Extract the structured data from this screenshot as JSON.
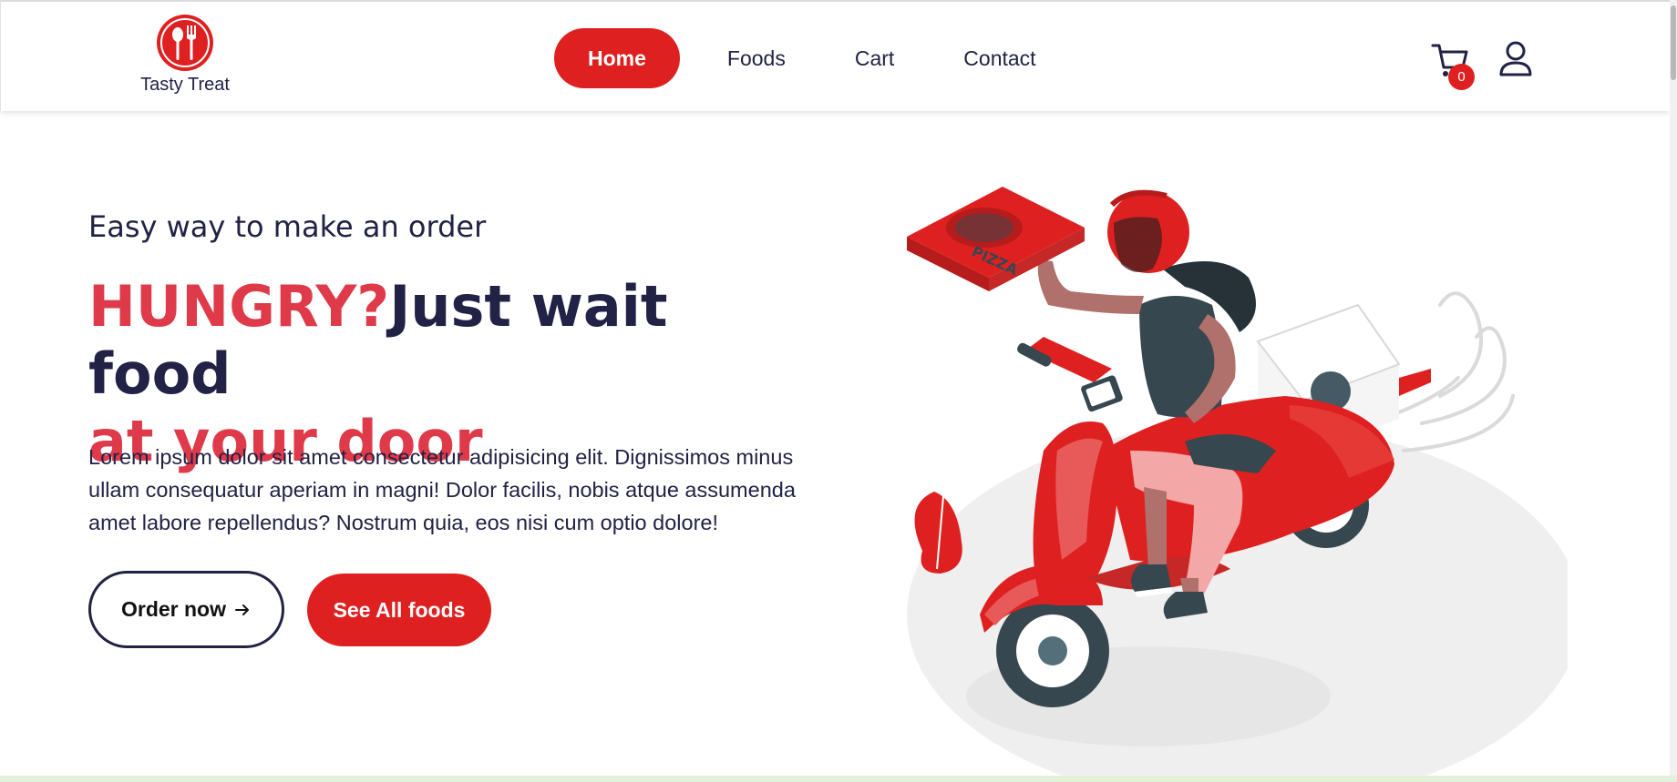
{
  "header": {
    "logo_text": "Tasty Treat",
    "nav": [
      {
        "label": "Home",
        "active": true
      },
      {
        "label": "Foods",
        "active": false
      },
      {
        "label": "Cart",
        "active": false
      },
      {
        "label": "Contact",
        "active": false
      }
    ],
    "cart_count": "0",
    "icons": {
      "cart": "cart-icon",
      "user": "user-icon",
      "logo": "spoon-fork-icon"
    }
  },
  "hero": {
    "subtitle": "Easy way to make an order",
    "title_red_1": "HUNGRY?",
    "title_dark": "Just wait food",
    "title_red_2": "at your door",
    "description": "Lorem ipsum dolor sit amet consectetur adipisicing elit. Dignissimos minus ullam consequatur aperiam in magni! Dolor facilis, nobis atque assumenda amet labore repellendus? Nostrum quia, eos nisi cum optio dolore!",
    "order_button": "Order now",
    "order_button_icon": "arrow-right-icon",
    "see_all_button": "See All foods",
    "illustration": "pizza-delivery-scooter-illustration",
    "pizza_box_text": "PIZZA"
  },
  "colors": {
    "brand_red": "#df2020",
    "title_red": "#df3a4a",
    "text_dark": "#212245"
  }
}
